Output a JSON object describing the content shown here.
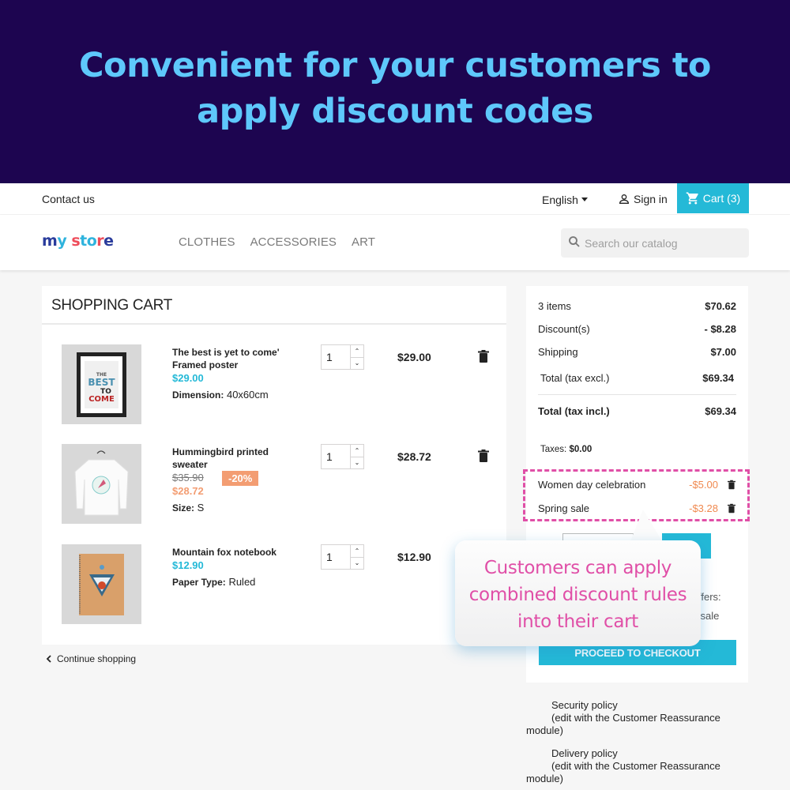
{
  "banner": {
    "title_line1": "Convenient for your customers to",
    "title_line2": "apply discount codes"
  },
  "topnav": {
    "contact": "Contact us",
    "language": "English",
    "signin": "Sign in",
    "cart": "Cart (3)"
  },
  "header": {
    "logo": "my store",
    "menu": [
      "CLOTHES",
      "ACCESSORIES",
      "ART"
    ],
    "search_placeholder": "Search our catalog"
  },
  "cart": {
    "title": "SHOPPING CART",
    "items": [
      {
        "name_line1": "The best is yet to come'",
        "name_line2": "Framed poster",
        "price": "$29.00",
        "attr_label": "Dimension:",
        "attr_value": "40x60cm",
        "qty": "1",
        "total": "$29.00"
      },
      {
        "name_line1": "Hummingbird printed",
        "name_line2": "sweater",
        "old_price": "$35.90",
        "discount_badge": "-20%",
        "price": "$28.72",
        "attr_label": "Size:",
        "attr_value": "S",
        "qty": "1",
        "total": "$28.72"
      },
      {
        "name_line1": "Mountain fox notebook",
        "price": "$12.90",
        "attr_label": "Paper Type:",
        "attr_value": "Ruled",
        "qty": "1",
        "total": "$12.90"
      }
    ],
    "continue": "Continue shopping"
  },
  "summary": {
    "items_label": "3 items",
    "items_value": "$70.62",
    "discount_label": "Discount(s)",
    "discount_value": "- $8.28",
    "shipping_label": "Shipping",
    "shipping_value": "$7.00",
    "total_excl_label": "Total (tax excl.)",
    "total_excl_value": "$69.34",
    "total_incl_label": "Total (tax incl.)",
    "total_incl_value": "$69.34",
    "taxes_label": "Taxes:",
    "taxes_value": "$0.00",
    "discounts": [
      {
        "name": "Women day celebration",
        "value": "-$5.00"
      },
      {
        "name": "Spring sale",
        "value": "-$3.28"
      }
    ],
    "offers_partial": "ffers:",
    "offer_partial": "l sale",
    "checkout": "PROCEED TO CHECKOUT"
  },
  "callout": {
    "line1": "Customers can apply",
    "line2": "combined discount rules",
    "line3": "into their cart"
  },
  "reassurance": [
    {
      "title": "Security policy",
      "line2": "(edit with the Customer Reassurance",
      "line3": "module)"
    },
    {
      "title": "Delivery policy",
      "line2": "(edit with the Customer Reassurance",
      "line3": "module)"
    }
  ],
  "colors": {
    "banner_bg": "#1d0550",
    "banner_text": "#5ec8fb",
    "accent": "#24b9d7",
    "discount": "#f39d72",
    "highlight": "#e04fa7"
  }
}
